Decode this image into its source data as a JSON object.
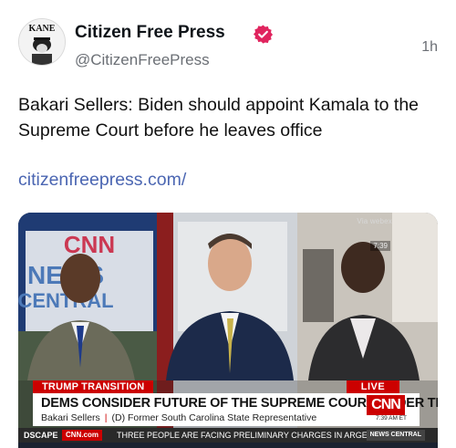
{
  "post": {
    "display_name": "Citizen Free Press",
    "handle": "@CitizenFreePress",
    "timestamp": "1h",
    "text": "Bakari Sellers: Biden should appoint Kamala to the Supreme Court before he leaves office",
    "link": "citizenfreepress.com/",
    "avatar_text": "KANE",
    "verified_color": "#e0245e",
    "link_color": "#4b66b2"
  },
  "media": {
    "via_label": "Via webex",
    "clock": "7:39",
    "background_logo": "NEWS CENTRAL",
    "tag": "TRUMP TRANSITION",
    "live": "LIVE",
    "headline": "DEMS CONSIDER FUTURE OF THE SUPREME COURT UNDER TRUMP",
    "guest_name": "Bakari Sellers",
    "guest_title": "(D) Former South Carolina State Representative",
    "logo": "CNN",
    "time": "7:39 AM ET",
    "ticker_left": "DSCAPE",
    "ticker_cnn": "CNN.com",
    "ticker_text": "THREE PEOPLE ARE FACING PRELIMINARY CHARGES IN ARGENT",
    "ticker_right": "NEWS CENTRAL",
    "accent_red": "#cc0000"
  }
}
